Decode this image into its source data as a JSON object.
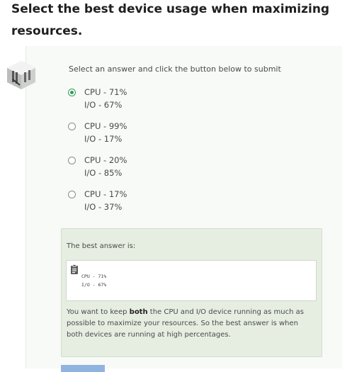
{
  "question": {
    "title": "Select the best device usage when maximizing resources."
  },
  "quiz": {
    "instruction": "Select an answer and click the button below to submit",
    "avatar_icon": "server-rack-icon",
    "accent_color": "#2f9e55",
    "selected_index": 0,
    "options": [
      {
        "cpu": "CPU - 71%",
        "io": "I/O - 67%",
        "selected": true
      },
      {
        "cpu": "CPU - 99%",
        "io": "I/O - 17%",
        "selected": false
      },
      {
        "cpu": "CPU - 20%",
        "io": "I/O - 85%",
        "selected": false
      },
      {
        "cpu": "CPU - 17%",
        "io": "I/O - 37%",
        "selected": false
      }
    ]
  },
  "feedback": {
    "heading": "The best answer is:",
    "clipboard_icon": "clipboard-icon",
    "code_lines": [
      "CPU - 71%",
      "I/O - 67%"
    ],
    "explanation_before": "You want to keep ",
    "explanation_bold": "both",
    "explanation_after": " the CPU and I/O device running as much as possible to maximize your resources. So the best answer is when both devices are running at high percentages."
  },
  "submit": {
    "color": "#8fb4e0"
  }
}
